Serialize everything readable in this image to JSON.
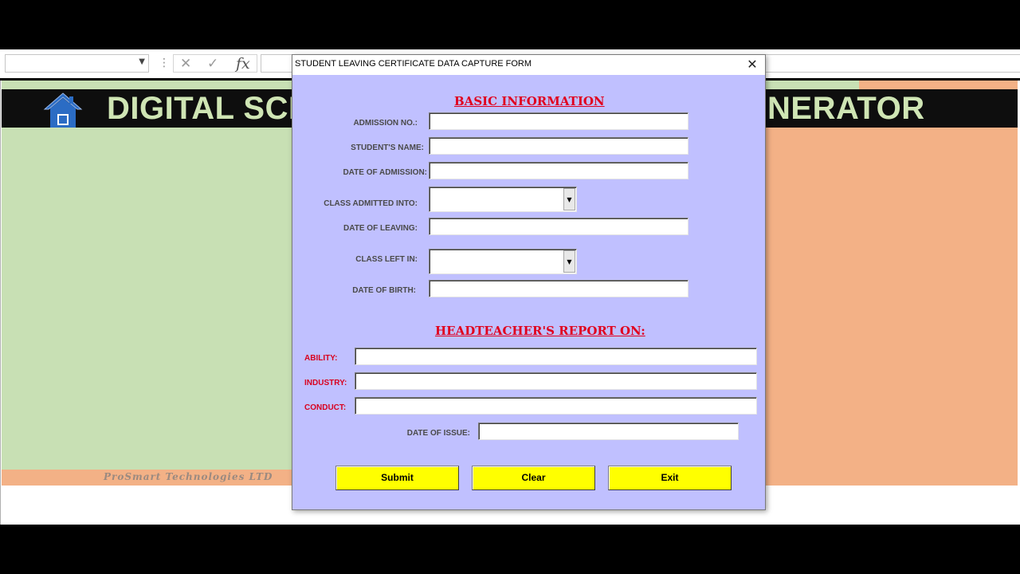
{
  "formula_bar": {
    "name_box_value": "",
    "separator_glyph": "⋮",
    "cancel_glyph": "✕",
    "enter_glyph": "✓",
    "fx_label": "fx",
    "formula_value": ""
  },
  "sheet": {
    "banner_left": "DIGITAL SCH",
    "banner_right": "NERATOR",
    "footer_text": "ProSmart Technologies LTD"
  },
  "dialog": {
    "title": "STUDENT LEAVING CERTIFICATE DATA CAPTURE FORM",
    "close_glyph": "✕",
    "basic_heading": "BASIC INFORMATION",
    "report_heading": "HEADTEACHER'S REPORT ON:",
    "fields": {
      "admission_no": {
        "label": "ADMISSION NO.:",
        "value": ""
      },
      "student_name": {
        "label": "STUDENT'S NAME:",
        "value": ""
      },
      "date_of_admission": {
        "label": "DATE OF ADMISSION:",
        "value": ""
      },
      "class_admitted": {
        "label": "CLASS ADMITTED INTO:",
        "value": ""
      },
      "date_of_leaving": {
        "label": "DATE OF LEAVING:",
        "value": ""
      },
      "class_left": {
        "label": "CLASS LEFT IN:",
        "value": ""
      },
      "date_of_birth": {
        "label": "DATE OF BIRTH:",
        "value": ""
      },
      "ability": {
        "label": "ABILITY:",
        "value": ""
      },
      "industry": {
        "label": "INDUSTRY:",
        "value": ""
      },
      "conduct": {
        "label": "CONDUCT:",
        "value": ""
      },
      "date_of_issue": {
        "label": "DATE OF ISSUE:",
        "value": ""
      }
    },
    "combo_arrow_glyph": "▼",
    "buttons": {
      "submit": "Submit",
      "clear": "Clear",
      "exit": "Exit"
    }
  },
  "colors": {
    "dialog_bg": "#c0c0ff",
    "heading_red": "#e0001e",
    "button_yellow": "#ffff00",
    "sheet_green": "#c8e0b4",
    "sheet_peach": "#f3b186",
    "banner_text": "#cfe5b4",
    "home_icon_blue": "#2b6cc4"
  }
}
